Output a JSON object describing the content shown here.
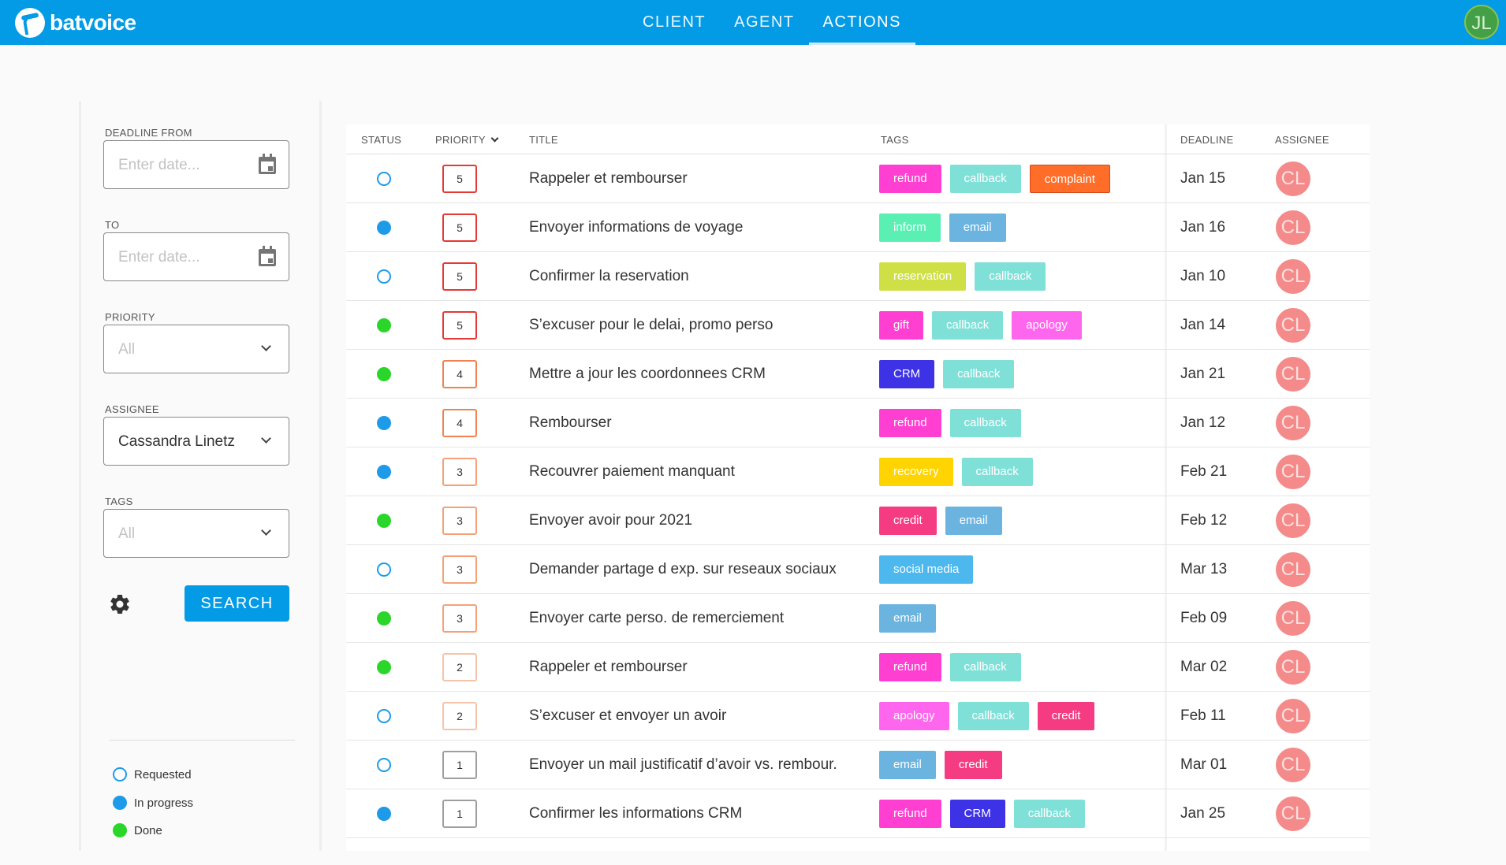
{
  "app": {
    "brand": "batvoice"
  },
  "nav": {
    "tabs": [
      {
        "label": "CLIENT"
      },
      {
        "label": "AGENT"
      },
      {
        "label": "ACTIONS"
      }
    ],
    "active": "ACTIONS"
  },
  "user": {
    "initials": "JL",
    "color": "#43a047"
  },
  "filters": {
    "deadline_from": {
      "label": "DEADLINE FROM",
      "placeholder": "Enter date..."
    },
    "deadline_to": {
      "label": "TO",
      "placeholder": "Enter date..."
    },
    "priority": {
      "label": "PRIORITY",
      "value": "All"
    },
    "assignee": {
      "label": "ASSIGNEE",
      "value": "Cassandra Linetz"
    },
    "tags": {
      "label": "TAGS",
      "value": "All"
    },
    "search_label": "SEARCH"
  },
  "legend": [
    {
      "label": "Requested",
      "status": "requested"
    },
    {
      "label": "In progress",
      "status": "progress"
    },
    {
      "label": "Done",
      "status": "done"
    }
  ],
  "table": {
    "headers": {
      "status": "STATUS",
      "priority": "PRIORITY",
      "title": "TITLE",
      "tags": "TAGS",
      "deadline": "DEADLINE",
      "assignee": "ASSIGNEE"
    },
    "rows": [
      {
        "status": "requested",
        "priority": "5",
        "title": "Rappeler et rembourser",
        "tags": [
          "refund",
          "callback",
          "complaint"
        ],
        "deadline": "Jan 15",
        "assignee": "CL"
      },
      {
        "status": "progress",
        "priority": "5",
        "title": "Envoyer informations de voyage",
        "tags": [
          "inform",
          "email"
        ],
        "deadline": "Jan 16",
        "assignee": "CL"
      },
      {
        "status": "requested",
        "priority": "5",
        "title": "Confirmer la reservation",
        "tags": [
          "reservation",
          "callback"
        ],
        "deadline": "Jan 10",
        "assignee": "CL"
      },
      {
        "status": "done",
        "priority": "5",
        "title": "S’excuser pour le delai, promo perso",
        "tags": [
          "gift",
          "callback",
          "apology"
        ],
        "deadline": "Jan 14",
        "assignee": "CL"
      },
      {
        "status": "done",
        "priority": "4",
        "title": "Mettre a jour les coordonnees CRM",
        "tags": [
          "CRM",
          "callback"
        ],
        "deadline": "Jan 21",
        "assignee": "CL"
      },
      {
        "status": "progress",
        "priority": "4",
        "title": "Rembourser",
        "tags": [
          "refund",
          "callback"
        ],
        "deadline": "Jan 12",
        "assignee": "CL"
      },
      {
        "status": "progress",
        "priority": "3",
        "title": "Recouvrer paiement manquant",
        "tags": [
          "recovery",
          "callback"
        ],
        "deadline": "Feb 21",
        "assignee": "CL"
      },
      {
        "status": "done",
        "priority": "3",
        "title": "Envoyer avoir pour 2021",
        "tags": [
          "credit",
          "email"
        ],
        "deadline": "Feb 12",
        "assignee": "CL"
      },
      {
        "status": "requested",
        "priority": "3",
        "title": "Demander partage d exp. sur reseaux sociaux",
        "tags": [
          "social media"
        ],
        "deadline": "Mar 13",
        "assignee": "CL"
      },
      {
        "status": "done",
        "priority": "3",
        "title": "Envoyer carte perso. de remerciement",
        "tags": [
          "email"
        ],
        "deadline": "Feb 09",
        "assignee": "CL"
      },
      {
        "status": "done",
        "priority": "2",
        "title": "Rappeler et rembourser",
        "tags": [
          "refund",
          "callback"
        ],
        "deadline": "Mar 02",
        "assignee": "CL"
      },
      {
        "status": "requested",
        "priority": "2",
        "title": "S’excuser et envoyer un avoir",
        "tags": [
          "apology",
          "callback",
          "credit"
        ],
        "deadline": "Feb 11",
        "assignee": "CL"
      },
      {
        "status": "requested",
        "priority": "1",
        "title": "Envoyer un mail justificatif d’avoir vs. rembour.",
        "tags": [
          "email",
          "credit"
        ],
        "deadline": "Mar 01",
        "assignee": "CL"
      },
      {
        "status": "progress",
        "priority": "1",
        "title": "Confirmer les informations CRM",
        "tags": [
          "refund",
          "CRM",
          "callback"
        ],
        "deadline": "Jan 25",
        "assignee": "CL"
      }
    ]
  },
  "colors": {
    "tags": {
      "refund": "#ff3fd2",
      "callback": "#7fe0d8",
      "complaint": "#ff6d28",
      "inform": "#5af0b4",
      "email": "#6bb4e0",
      "reservation": "#cfe046",
      "gift": "#ff3fd2",
      "apology": "#ff66ee",
      "CRM": "#3d32e6",
      "recovery": "#ffd400",
      "credit": "#f53c82",
      "social media": "#4cb8ee"
    },
    "priority": {
      "5": "#e53935",
      "4": "#f0824f",
      "3": "#f5a077",
      "2": "#f5c4a8",
      "1": "#9e9e9e"
    }
  }
}
